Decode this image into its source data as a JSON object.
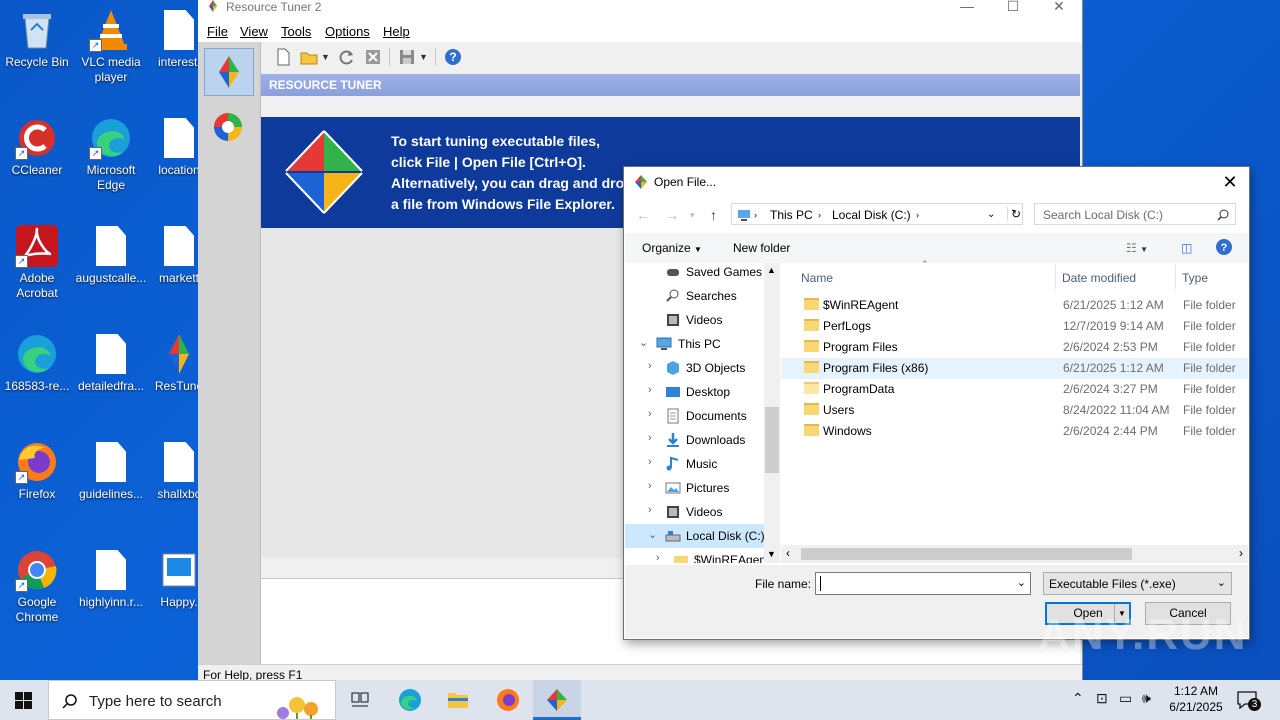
{
  "desktop": {
    "icons": [
      {
        "label": "Recycle Bin"
      },
      {
        "label": "VLC media player"
      },
      {
        "label": "interesti"
      },
      {
        "label": "CCleaner"
      },
      {
        "label": "Microsoft Edge"
      },
      {
        "label": "location"
      },
      {
        "label": "Adobe Acrobat"
      },
      {
        "label": "augustcalle..."
      },
      {
        "label": "markett"
      },
      {
        "label": "168583-re..."
      },
      {
        "label": "detailedfra..."
      },
      {
        "label": "ResTune"
      },
      {
        "label": "Firefox"
      },
      {
        "label": "guidelines..."
      },
      {
        "label": "shallxbc"
      },
      {
        "label": "Google Chrome"
      },
      {
        "label": "highlyinn.r..."
      },
      {
        "label": "Happy."
      }
    ]
  },
  "resource_tuner": {
    "title": "Resource Tuner 2",
    "menu": [
      "File",
      "View",
      "Tools",
      "Options",
      "Help"
    ],
    "header": "RESOURCE TUNER",
    "banner_lines": [
      "To start tuning executable files,",
      "click File | Open File [Ctrl+O].",
      "Alternatively, you can drag and drop",
      "a file from Windows File Explorer."
    ],
    "status": "For Help, press F1"
  },
  "open_dialog": {
    "title": "Open File...",
    "breadcrumb": [
      "This PC",
      "Local Disk (C:)"
    ],
    "search_placeholder": "Search Local Disk (C:)",
    "organize": "Organize",
    "new_folder": "New folder",
    "nav_items": [
      {
        "label": "Saved Games",
        "icon": "saved-games-icon",
        "indent": 1,
        "chevron": ""
      },
      {
        "label": "Searches",
        "icon": "search-icon",
        "indent": 1,
        "chevron": ""
      },
      {
        "label": "Videos",
        "icon": "videos-icon",
        "indent": 1,
        "chevron": ""
      },
      {
        "label": "This PC",
        "icon": "pc-icon",
        "indent": 0,
        "chevron": "down"
      },
      {
        "label": "3D Objects",
        "icon": "3d-objects-icon",
        "indent": 1,
        "chevron": "right"
      },
      {
        "label": "Desktop",
        "icon": "desktop-icon",
        "indent": 1,
        "chevron": "right"
      },
      {
        "label": "Documents",
        "icon": "documents-icon",
        "indent": 1,
        "chevron": "right"
      },
      {
        "label": "Downloads",
        "icon": "downloads-icon",
        "indent": 1,
        "chevron": "right"
      },
      {
        "label": "Music",
        "icon": "music-icon",
        "indent": 1,
        "chevron": "right"
      },
      {
        "label": "Pictures",
        "icon": "pictures-icon",
        "indent": 1,
        "chevron": "right"
      },
      {
        "label": "Videos",
        "icon": "videos-icon",
        "indent": 1,
        "chevron": "right"
      },
      {
        "label": "Local Disk (C:)",
        "icon": "disk-icon",
        "indent": 1,
        "chevron": "down",
        "selected": true
      },
      {
        "label": "$WinREAgent",
        "icon": "folder-icon",
        "indent": 2,
        "chevron": "right"
      }
    ],
    "columns": {
      "name": "Name",
      "date": "Date modified",
      "type": "Type"
    },
    "files": [
      {
        "name": "$WinREAgent",
        "date": "6/21/2025 1:12 AM",
        "type": "File folder"
      },
      {
        "name": "PerfLogs",
        "date": "12/7/2019 9:14 AM",
        "type": "File folder"
      },
      {
        "name": "Program Files",
        "date": "2/6/2024 2:53 PM",
        "type": "File folder"
      },
      {
        "name": "Program Files (x86)",
        "date": "6/21/2025 1:12 AM",
        "type": "File folder",
        "hover": true
      },
      {
        "name": "ProgramData",
        "date": "2/6/2024 3:27 PM",
        "type": "File folder"
      },
      {
        "name": "Users",
        "date": "8/24/2022 11:04 AM",
        "type": "File folder"
      },
      {
        "name": "Windows",
        "date": "2/6/2024 2:44 PM",
        "type": "File folder"
      }
    ],
    "file_name_label": "File name:",
    "file_name_value": "",
    "filter": "Executable Files (*.exe)",
    "open_button": "Open",
    "cancel_button": "Cancel"
  },
  "taskbar": {
    "search_placeholder": "Type here to search",
    "time": "1:12 AM",
    "date": "6/21/2025",
    "notification_count": "3"
  },
  "watermark": "ANY.RUN"
}
